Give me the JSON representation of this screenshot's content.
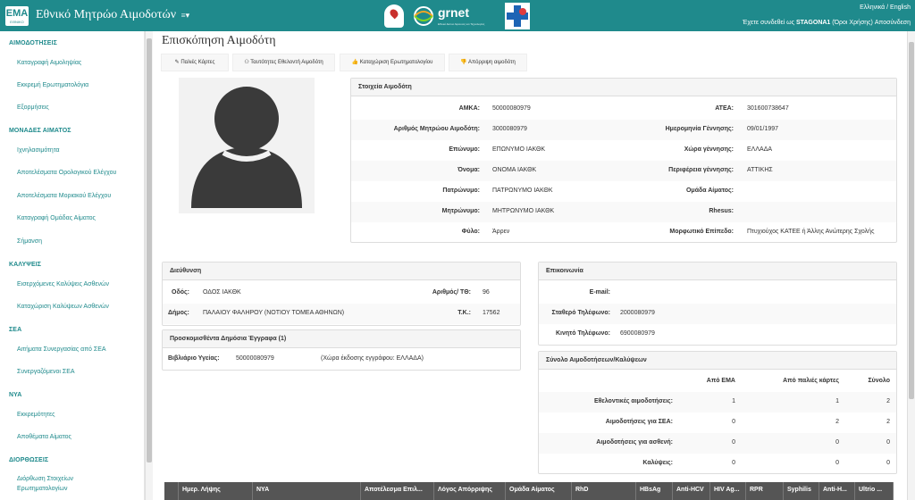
{
  "header": {
    "logo_text": "ΕΜΑ",
    "logo_sub": "ΕΘΝΙΚΟ",
    "title": "Εθνικό Μητρώο Αιμοδοτών",
    "title_caret": "≡▾",
    "lang": "Ελληνικά / English",
    "grnet": "grnet",
    "grnet_sub": "Εθνικό Δίκτυο Έρευνας και Τεχνολογίας",
    "user_prefix": "Έχετε συνδεθεί ως",
    "user_name": "STAGONA1",
    "terms": "(Όροι Χρήσης)",
    "logout": "Αποσύνδεση"
  },
  "sidebar": {
    "sections": [
      {
        "title": "ΑΙΜΟΔΟΤΗΣΕΙΣ",
        "items": [
          "Καταγραφή Αιμοληψίας",
          "Εκκρεμή Ερωτηματολόγια",
          "Εξορμήσεις"
        ]
      },
      {
        "title": "ΜΟΝΑΔΕΣ ΑΙΜΑΤΟΣ",
        "items": [
          "Ιχνηλασιμότητα",
          "Αποτελέσματα Ορολογικού Ελέγχου",
          "Αποτελέσματα Μοριακού Ελέγχου",
          "Καταγραφή Ομάδας Αίματος",
          "Σήμανση"
        ]
      },
      {
        "title": "ΚΑΛΥΨΕΙΣ",
        "items": [
          "Εισερχόμενες Καλύψεις Ασθενών",
          "Καταχώριση Καλύψεων Ασθενών"
        ]
      },
      {
        "title": "ΣΕΑ",
        "items": [
          "Αιτήματα Συνεργασίας από ΣΕΑ",
          "Συνεργαζόμενοι ΣΕΑ"
        ]
      },
      {
        "title": "ΝΥΑ",
        "items": [
          "Εκκρεμότητες",
          "Αποθέματα Αίματος"
        ]
      },
      {
        "title": "ΔΙΟΡΘΩΣΕΙΣ",
        "items": [
          "Διόρθωση Στοιχείων Ερωτηματολογίων"
        ]
      }
    ]
  },
  "page": {
    "title": "Επισκόπηση Αιμοδότη",
    "tabs": [
      {
        "icon": "edit-icon",
        "glyph": "✎",
        "label": "Παλιές Κάρτες"
      },
      {
        "icon": "binoculars-icon",
        "glyph": "⚇",
        "label": "Ταυτότητες Εθελοντή Αιμοδότη"
      },
      {
        "icon": "thumbs-up-icon",
        "glyph": "👍",
        "label": "Καταχώριση Ερωτηματολογίου"
      },
      {
        "icon": "thumbs-down-icon",
        "glyph": "👎",
        "label": "Απόρριψη αιμοδότη"
      }
    ]
  },
  "donor": {
    "title": "Στοιχεία Αιμοδότη",
    "rows": [
      {
        "l1": "ΑΜΚΑ:",
        "v1": "50000080979",
        "l2": "ΑΤΕΑ:",
        "v2": "301600738647"
      },
      {
        "l1": "Αριθμός Μητρώου Αιμοδότη:",
        "v1": "3000080979",
        "l2": "Ημερομηνία Γέννησης:",
        "v2": "09/01/1997"
      },
      {
        "l1": "Επώνυμο:",
        "v1": "ΕΠΩΝΥΜΟ ΙΑΚΘΚ",
        "l2": "Χώρα γέννησης:",
        "v2": "ΕΛΛΑΔΑ"
      },
      {
        "l1": "Όνομα:",
        "v1": "ΟΝΟΜΑ ΙΑΚΘΚ",
        "l2": "Περιφέρεια γέννησης:",
        "v2": "ΑΤΤΙΚΗΣ"
      },
      {
        "l1": "Πατρώνυμο:",
        "v1": "ΠΑΤΡΩΝΥΜΟ ΙΑΚΘΚ",
        "l2": "Ομάδα Αίματος:",
        "v2": ""
      },
      {
        "l1": "Μητρώνυμο:",
        "v1": "ΜΗΤΡΩΝΥΜΟ ΙΑΚΘΚ",
        "l2": "Rhesus:",
        "v2": ""
      },
      {
        "l1": "Φύλο:",
        "v1": "Άρρεν",
        "l2": "Μορφωτικό Επίπεδο:",
        "v2": "Πτυχιούχος ΚΑΤΕΕ ή Άλλης Ανώτερης Σχολής"
      }
    ]
  },
  "address": {
    "title": "Διεύθυνση",
    "street_label": "Οδός:",
    "street": "ΟΔΟΣ ΙΑΚΘΚ",
    "num_label": "Αριθμός/ ΤΘ:",
    "num": "96",
    "municipality_label": "Δήμος:",
    "municipality": "ΠΑΛΑΙΟΥ ΦΑΛΗΡΟΥ (ΝΟΤΙΟΥ ΤΟΜΕΑ ΑΘΗΝΩΝ)",
    "tk_label": "Τ.Κ.:",
    "tk": "17562"
  },
  "documents": {
    "title": "Προσκομισθέντα Δημόσια Έγγραφα (1)",
    "doc_label": "Βιβλιάριο Υγείας:",
    "doc_value": "50000080979",
    "country_label": "(Χώρα έκδοσης εγγράφου:",
    "country_value": "ΕΛΛΑΔΑ)"
  },
  "contact": {
    "title": "Επικοινωνία",
    "email_label": "E-mail:",
    "email": "",
    "phone_label": "Σταθερό Τηλέφωνο:",
    "phone": "2000080979",
    "mobile_label": "Κινητό Τηλέφωνο:",
    "mobile": "6900080979"
  },
  "summary": {
    "title": "Σύνολο Αιμοδοτήσεων/Καλύψεων",
    "columns": [
      "Από ΕΜΑ",
      "Από παλιές κάρτες",
      "Σύνολο"
    ],
    "rows": [
      {
        "label": "Εθελοντικές αιμοδοτήσεις:",
        "values": [
          "1",
          "1",
          "2"
        ]
      },
      {
        "label": "Αιμοδοτήσεις για ΣΕΑ:",
        "values": [
          "0",
          "2",
          "2"
        ]
      },
      {
        "label": "Αιμοδοτήσεις για ασθενή:",
        "values": [
          "0",
          "0",
          "0"
        ]
      },
      {
        "label": "Καλύψεις:",
        "values": [
          "0",
          "0",
          "0"
        ]
      }
    ]
  },
  "bottom_table": {
    "columns": [
      "Ημερ. Λήψης",
      "ΝΥΑ",
      "Αποτέλεσμα Επιλ...",
      "Λόγος Απόρριψης",
      "Ομάδα Αίματος",
      "RhD",
      "HBsAg",
      "Anti-HCV",
      "HIV Ag...",
      "RPR",
      "Syphilis",
      "Anti-H...",
      "Ultrio ..."
    ]
  }
}
